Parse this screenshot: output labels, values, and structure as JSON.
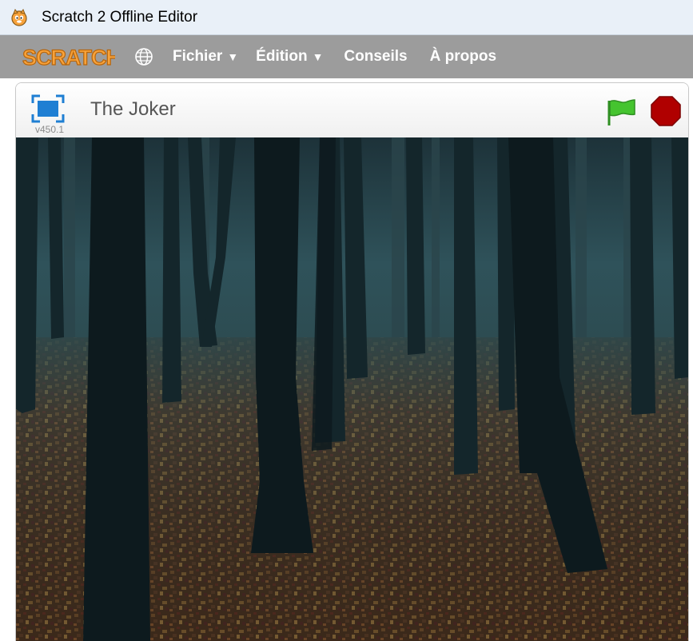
{
  "window": {
    "title": "Scratch 2 Offline Editor"
  },
  "menubar": {
    "logo_text": "SCRATCH",
    "globe_icon": "globe-icon",
    "items": [
      {
        "label": "Fichier",
        "has_caret": true
      },
      {
        "label": "Édition",
        "has_caret": true
      },
      {
        "label": "Conseils",
        "has_caret": false
      },
      {
        "label": "À propos",
        "has_caret": false
      }
    ],
    "caret": "▼"
  },
  "stage": {
    "project_title": "The Joker",
    "version": "v450.1",
    "icons": {
      "fullscreen": "fullscreen-icon",
      "green_flag": "green-flag-icon",
      "stop": "stop-icon"
    },
    "backdrop": "dark misty forest with fallen leaves"
  },
  "colors": {
    "titlebar_bg": "#e9f0f8",
    "menubar_bg": "#9c9c9c",
    "logo_orange": "#f7a23b",
    "flag_green": "#3fbf2e",
    "stop_red": "#b00000",
    "fullscreen_blue": "#1f7fd3",
    "fog": "#2e4f56",
    "ground": "#4a3223"
  }
}
